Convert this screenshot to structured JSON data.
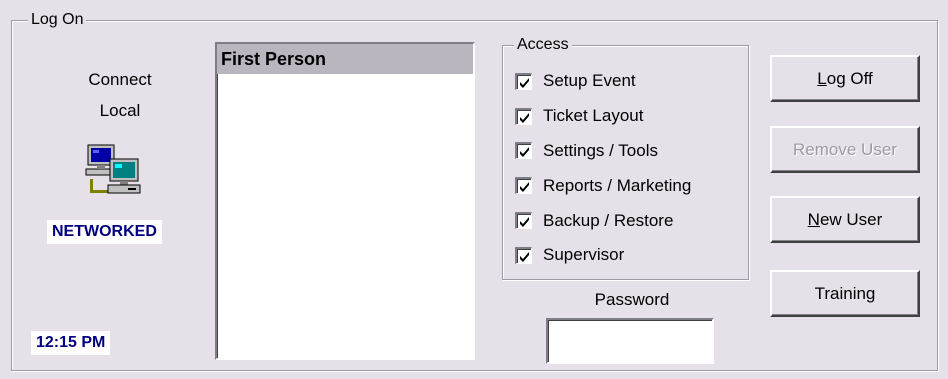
{
  "logon_group": {
    "title": "Log On"
  },
  "connection": {
    "line1": "Connect",
    "line2": "Local",
    "status_badge": "NETWORKED",
    "time": "12:15 PM",
    "icon": "networked-computers-icon"
  },
  "users": {
    "items": [
      {
        "label": "First Person",
        "selected": true
      }
    ]
  },
  "access_group": {
    "title": "Access",
    "items": [
      {
        "label": "Setup Event",
        "checked": true
      },
      {
        "label": "Ticket Layout",
        "checked": true
      },
      {
        "label": "Settings / Tools",
        "checked": true
      },
      {
        "label": "Reports / Marketing",
        "checked": true
      },
      {
        "label": "Backup / Restore",
        "checked": true
      },
      {
        "label": "Supervisor",
        "checked": true
      }
    ]
  },
  "password": {
    "label": "Password",
    "value": ""
  },
  "buttons": {
    "log_off": {
      "mnemonic": "L",
      "rest": "og Off",
      "enabled": true
    },
    "remove_user": {
      "label": "Remove User",
      "enabled": false
    },
    "new_user": {
      "mnemonic": "N",
      "rest": "ew User",
      "enabled": true
    },
    "training": {
      "label": "Training",
      "enabled": true
    }
  },
  "colors": {
    "dialog_bg": "#e6e1e9",
    "selection_bg": "#b9b6bf",
    "badge_text": "#00007f",
    "disabled_text": "#9c9aa2"
  }
}
